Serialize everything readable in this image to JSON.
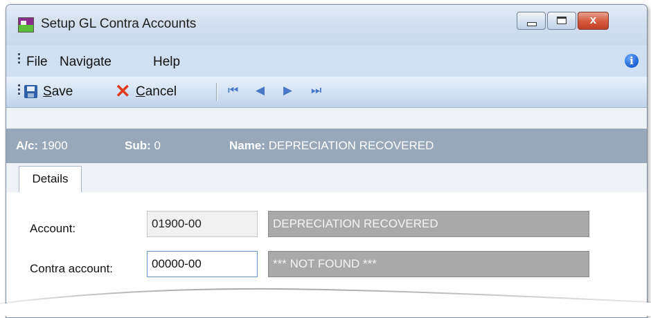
{
  "window": {
    "title": "Setup GL Contra Accounts",
    "close_glyph": "x"
  },
  "menu": {
    "items": [
      "File",
      "Navigate",
      "Help"
    ]
  },
  "toolbar": {
    "save_label_first": "S",
    "save_label_rest": "ave",
    "cancel_label_first": "C",
    "cancel_label_rest": "ancel",
    "nav_glyphs": [
      "⏮",
      "◀",
      "▶",
      "⏭"
    ]
  },
  "header": {
    "ac_label": "A/c:",
    "ac_value": "1900",
    "sub_label": "Sub:",
    "sub_value": "0",
    "name_label": "Name:",
    "name_value": "DEPRECIATION RECOVERED"
  },
  "tabs": [
    "Details"
  ],
  "form": {
    "account_label": "Account:",
    "account_value": "01900-00",
    "account_name": "DEPRECIATION RECOVERED",
    "contra_label": "Contra account:",
    "contra_value": "00000-00",
    "contra_name": "*** NOT FOUND ***"
  },
  "icons": {
    "app": "app-icon",
    "info": "info-icon",
    "save": "save-icon",
    "cancel": "cancel-icon"
  }
}
